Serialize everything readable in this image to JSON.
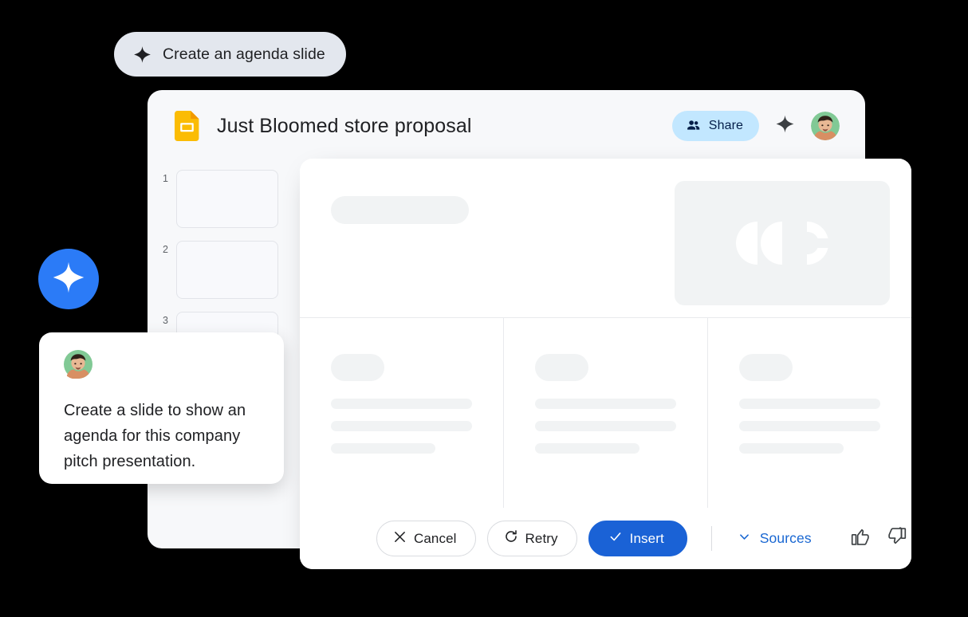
{
  "background_color": "#000000",
  "suggestion_chip": {
    "label": "Create an agenda slide",
    "icon": "sparkle-icon",
    "background_color": "#e3e7ee"
  },
  "gemini_badge": {
    "icon": "gemini-sparkle-icon",
    "color": "#2b7bf7"
  },
  "slides_window": {
    "background_color": "#f7f8fa",
    "header": {
      "doc_icon": "google-slides-icon",
      "doc_icon_color": "#fbbc04",
      "title": "Just Bloomed store proposal",
      "share": {
        "label": "Share",
        "icon": "people-icon",
        "background_color": "#c2e7ff",
        "text_color": "#041e49"
      },
      "sparkle_icon": "sparkle-icon",
      "avatar": "user-avatar"
    },
    "filmstrip": {
      "slides": [
        {
          "number": "1"
        },
        {
          "number": "2"
        },
        {
          "number": "3"
        }
      ]
    }
  },
  "overlay_card": {
    "slide_preview": {
      "title_placeholder": "title-placeholder",
      "image_placeholder": "image-placeholder",
      "columns": [
        {
          "heading_placeholder": "heading-placeholder",
          "lines": 3
        },
        {
          "heading_placeholder": "heading-placeholder",
          "lines": 3
        },
        {
          "heading_placeholder": "heading-placeholder",
          "lines": 3
        }
      ],
      "placeholder_color": "#f1f3f4"
    },
    "action_bar": {
      "cancel": {
        "label": "Cancel",
        "icon": "close-icon"
      },
      "retry": {
        "label": "Retry",
        "icon": "refresh-icon"
      },
      "insert": {
        "label": "Insert",
        "icon": "check-icon",
        "background_color": "#1a62d6"
      },
      "sources": {
        "label": "Sources",
        "icon": "chevron-down-icon",
        "text_color": "#1967d2"
      },
      "thumb_up": "thumb-up-icon",
      "thumb_down": "thumb-down-icon"
    }
  },
  "prompt_card": {
    "avatar": "user-avatar",
    "text": "Create a slide to show an agenda for this company pitch presentation."
  }
}
